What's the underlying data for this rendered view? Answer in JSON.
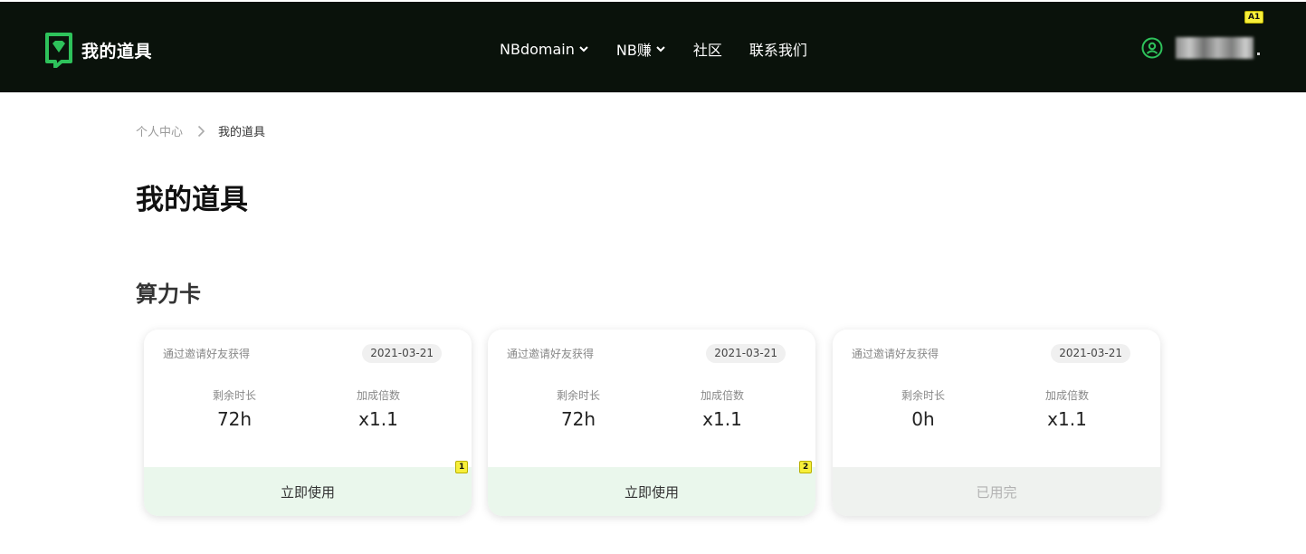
{
  "brand": {
    "name": "我的道具"
  },
  "nav": {
    "items": [
      {
        "label": "NBdomain",
        "has_dropdown": true
      },
      {
        "label": "NB赚",
        "has_dropdown": true
      },
      {
        "label": "社区",
        "has_dropdown": false
      },
      {
        "label": "联系我们",
        "has_dropdown": false
      }
    ]
  },
  "user": {
    "icon": "user-circle-icon"
  },
  "badges": {
    "a1": "A1",
    "card1": "1",
    "card2": "2"
  },
  "breadcrumb": {
    "home": "个人中心",
    "current": "我的道具"
  },
  "page": {
    "title": "我的道具",
    "section_title": "算力卡"
  },
  "cards": [
    {
      "source": "通过邀请好友获得",
      "date": "2021-03-21",
      "remaining_label": "剩余时长",
      "remaining_value": "72h",
      "multiplier_label": "加成倍数",
      "multiplier_value": "x1.1",
      "action": "立即使用",
      "state": "active"
    },
    {
      "source": "通过邀请好友获得",
      "date": "2021-03-21",
      "remaining_label": "剩余时长",
      "remaining_value": "72h",
      "multiplier_label": "加成倍数",
      "multiplier_value": "x1.1",
      "action": "立即使用",
      "state": "active"
    },
    {
      "source": "通过邀请好友获得",
      "date": "2021-03-21",
      "remaining_label": "剩余时长",
      "remaining_value": "0h",
      "multiplier_label": "加成倍数",
      "multiplier_value": "x1.1",
      "action": "已用完",
      "state": "used"
    }
  ],
  "colors": {
    "navbar_bg": "#0a120b",
    "brand_green": "#2ec25b",
    "action_bg": "#eaf7ec",
    "used_bg": "#eff2ef",
    "badge_yellow": "#f7ef3a"
  }
}
